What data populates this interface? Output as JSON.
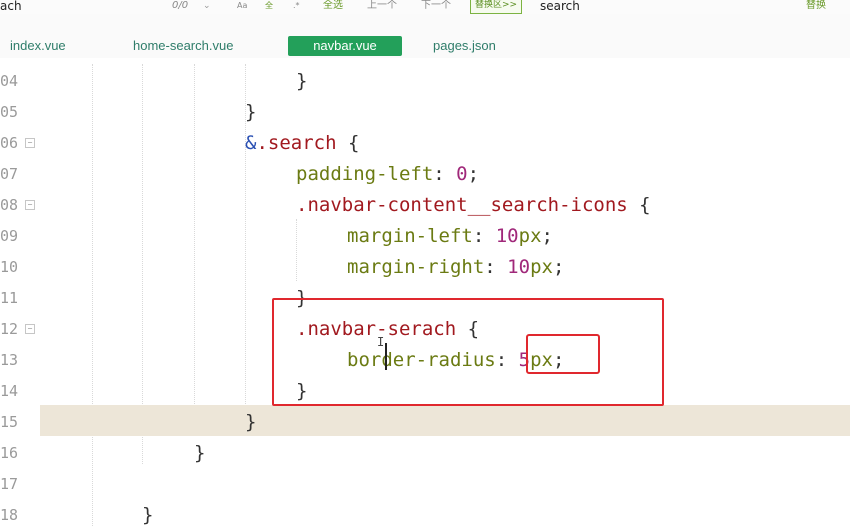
{
  "find_bar": {
    "find_value": "ach",
    "count": "0/0",
    "chevron": "⌄",
    "opt_case": "Aa",
    "opt_word": "全",
    "opt_regex": ".*",
    "select_all": "全选",
    "prev": "上一个",
    "next": "下一个",
    "toggle_replace": "替换区>>",
    "replace_value": "search",
    "replace_button": "替换"
  },
  "tabs": [
    {
      "label": "index.vue",
      "active": false
    },
    {
      "label": "home-search.vue",
      "active": false
    },
    {
      "label": "navbar.vue",
      "active": true
    },
    {
      "label": "pages.json",
      "active": false
    }
  ],
  "colors": {
    "accent_tab": "#23a05a",
    "tab_text": "#2f7d6a",
    "annotation_red": "#e0282e",
    "current_line": "#ede6d8"
  },
  "lines": [
    {
      "num": "04",
      "fold": false,
      "text": "}"
    },
    {
      "num": "05",
      "fold": false,
      "text": "}"
    },
    {
      "num": "06",
      "fold": true,
      "amp": "&",
      "selector": ".search",
      "brace": " {"
    },
    {
      "num": "07",
      "fold": false,
      "prop": "padding-left",
      "colon": ": ",
      "value": "0",
      "semi": ";"
    },
    {
      "num": "08",
      "fold": true,
      "selector": ".navbar-content__search-icons",
      "brace": " {"
    },
    {
      "num": "09",
      "fold": false,
      "prop": "margin-left",
      "colon": ": ",
      "value": "10",
      "unit": "px",
      "semi": ";"
    },
    {
      "num": "10",
      "fold": false,
      "prop": "margin-right",
      "colon": ": ",
      "value": "10",
      "unit": "px",
      "semi": ";"
    },
    {
      "num": "11",
      "fold": false,
      "text": "}"
    },
    {
      "num": "12",
      "fold": true,
      "selector": ".navbar-serach",
      "brace": " {"
    },
    {
      "num": "13",
      "fold": false,
      "prop": "border-radius",
      "colon": ": ",
      "value": "5",
      "unit": "px",
      "semi": ";"
    },
    {
      "num": "14",
      "fold": false,
      "text": "}"
    },
    {
      "num": "15",
      "fold": false,
      "text": "}"
    },
    {
      "num": "16",
      "fold": false,
      "text": "}"
    },
    {
      "num": "17",
      "fold": false,
      "text": ""
    },
    {
      "num": "18",
      "fold": false,
      "text": "}"
    }
  ]
}
